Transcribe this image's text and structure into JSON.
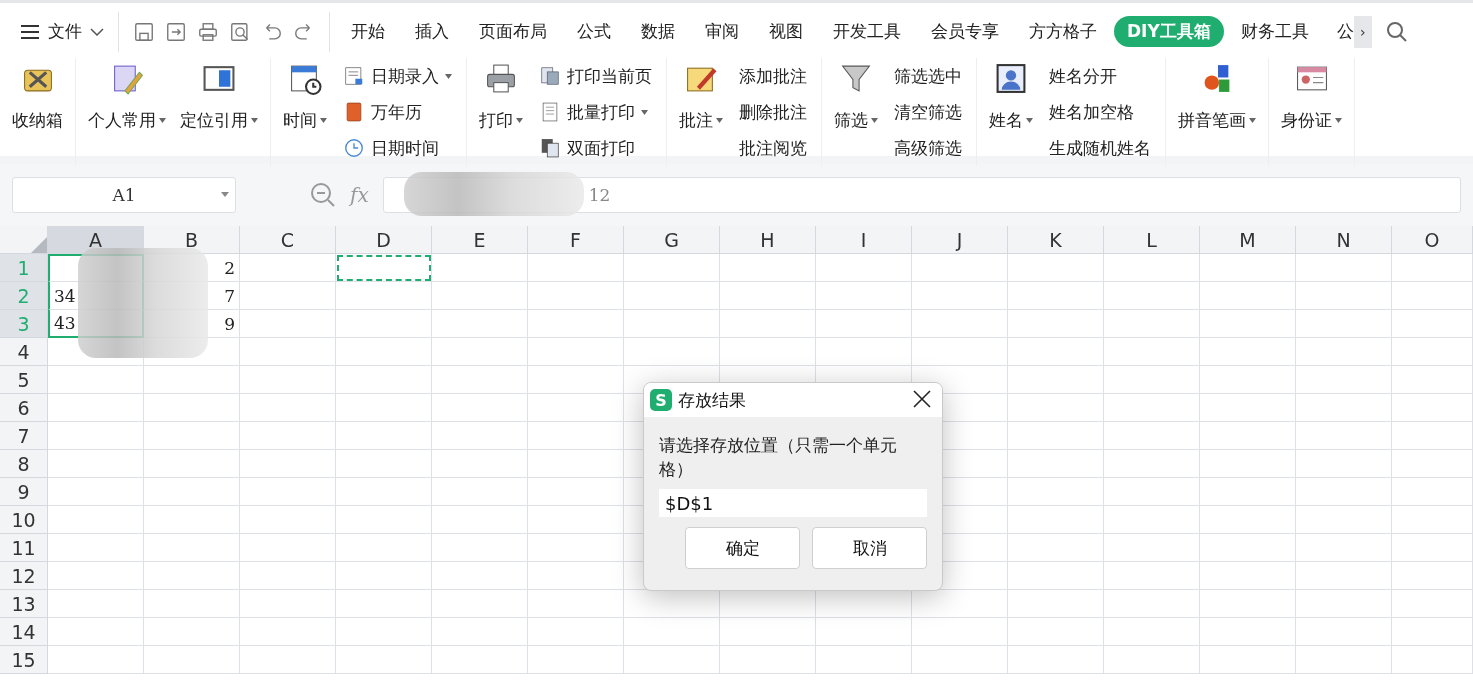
{
  "menu": {
    "label": "文件"
  },
  "tabs": [
    {
      "label": "开始",
      "selected": false
    },
    {
      "label": "插入",
      "selected": false
    },
    {
      "label": "页面布局",
      "selected": false
    },
    {
      "label": "公式",
      "selected": false
    },
    {
      "label": "数据",
      "selected": false
    },
    {
      "label": "审阅",
      "selected": false
    },
    {
      "label": "视图",
      "selected": false
    },
    {
      "label": "开发工具",
      "selected": false
    },
    {
      "label": "会员专享",
      "selected": false
    },
    {
      "label": "方方格子",
      "selected": false
    },
    {
      "label": "DIY工具箱",
      "selected": true
    },
    {
      "label": "财务工具",
      "selected": false
    },
    {
      "label": "公",
      "selected": false
    }
  ],
  "tab_scroll": {
    "label": "›"
  },
  "ribbon": {
    "groups": [
      {
        "items": [
          {
            "kind": "large",
            "label": "收纳箱",
            "dropdown": false
          }
        ]
      },
      {
        "items": [
          {
            "kind": "large",
            "label": "个人常用",
            "dropdown": true
          },
          {
            "kind": "large",
            "label": "定位引用",
            "dropdown": true
          }
        ]
      },
      {
        "items": [
          {
            "kind": "large",
            "label": "时间",
            "dropdown": true
          },
          {
            "kind": "stack",
            "entries": [
              {
                "label": "日期录入",
                "dropdown": true
              },
              {
                "label": "万年历",
                "dropdown": false
              },
              {
                "label": "日期时间",
                "dropdown": false
              }
            ]
          }
        ]
      },
      {
        "items": [
          {
            "kind": "large",
            "label": "打印",
            "dropdown": true
          },
          {
            "kind": "stack",
            "entries": [
              {
                "label": "打印当前页",
                "dropdown": false
              },
              {
                "label": "批量打印",
                "dropdown": true
              },
              {
                "label": "双面打印",
                "dropdown": false
              }
            ]
          }
        ]
      },
      {
        "items": [
          {
            "kind": "large",
            "label": "批注",
            "dropdown": true
          },
          {
            "kind": "stack",
            "entries": [
              {
                "label": "添加批注",
                "dropdown": false
              },
              {
                "label": "删除批注",
                "dropdown": false
              },
              {
                "label": "批注阅览",
                "dropdown": false
              }
            ]
          }
        ]
      },
      {
        "items": [
          {
            "kind": "large",
            "label": "筛选",
            "dropdown": true
          },
          {
            "kind": "stack",
            "entries": [
              {
                "label": "筛选选中",
                "dropdown": false
              },
              {
                "label": "清空筛选",
                "dropdown": false
              },
              {
                "label": "高级筛选",
                "dropdown": false
              }
            ]
          }
        ]
      },
      {
        "items": [
          {
            "kind": "large",
            "label": "姓名",
            "dropdown": true
          },
          {
            "kind": "stack",
            "entries": [
              {
                "label": "姓名分开",
                "dropdown": false
              },
              {
                "label": "姓名加空格",
                "dropdown": false
              },
              {
                "label": "生成随机姓名",
                "dropdown": false
              }
            ]
          }
        ]
      },
      {
        "items": [
          {
            "kind": "large",
            "label": "拼音笔画",
            "dropdown": true
          }
        ]
      },
      {
        "items": [
          {
            "kind": "large",
            "label": "身份证",
            "dropdown": true
          }
        ]
      }
    ]
  },
  "formula_bar": {
    "name_box": "A1",
    "fx": "fx",
    "value": "12"
  },
  "columns": [
    {
      "label": "A",
      "selected": true,
      "target": false
    },
    {
      "label": "B",
      "selected": false,
      "target": false
    },
    {
      "label": "C",
      "selected": false,
      "target": false
    },
    {
      "label": "D",
      "selected": false,
      "target": true
    },
    {
      "label": "E",
      "selected": false,
      "target": false
    },
    {
      "label": "F",
      "selected": false,
      "target": false
    },
    {
      "label": "G",
      "selected": false,
      "target": false
    },
    {
      "label": "H",
      "selected": false,
      "target": false
    },
    {
      "label": "I",
      "selected": false,
      "target": false
    },
    {
      "label": "J",
      "selected": false,
      "target": false
    },
    {
      "label": "K",
      "selected": false,
      "target": false
    },
    {
      "label": "L",
      "selected": false,
      "target": false
    },
    {
      "label": "M",
      "selected": false,
      "target": false
    },
    {
      "label": "N",
      "selected": false,
      "target": false
    },
    {
      "label": "O",
      "selected": false,
      "target": false
    }
  ],
  "rows": [
    {
      "label": "1",
      "selected": true,
      "b": "2"
    },
    {
      "label": "2",
      "selected": true,
      "a": "34",
      "b": "7"
    },
    {
      "label": "3",
      "selected": true,
      "a": "43",
      "b": "9"
    },
    {
      "label": "4",
      "selected": false
    },
    {
      "label": "5",
      "selected": false
    },
    {
      "label": "6",
      "selected": false
    },
    {
      "label": "7",
      "selected": false
    },
    {
      "label": "8",
      "selected": false
    },
    {
      "label": "9",
      "selected": false
    },
    {
      "label": "10",
      "selected": false
    },
    {
      "label": "11",
      "selected": false
    },
    {
      "label": "12",
      "selected": false
    },
    {
      "label": "13",
      "selected": false
    },
    {
      "label": "14",
      "selected": false
    },
    {
      "label": "15",
      "selected": false
    }
  ],
  "dialog": {
    "icon": "S",
    "title": "存放结果",
    "message": "请选择存放位置（只需一个单元格）",
    "value": "$D$1",
    "buttons": [
      "确定",
      "取消"
    ]
  }
}
